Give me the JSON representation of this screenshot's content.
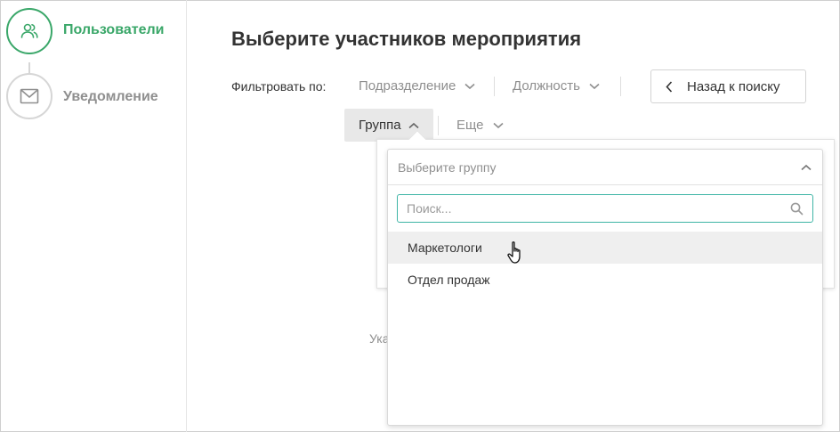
{
  "sidebar": {
    "steps": [
      {
        "label": "Пользователи",
        "icon": "users-icon",
        "state": "active"
      },
      {
        "label": "Уведомление",
        "icon": "envelope-icon",
        "state": "inactive"
      }
    ]
  },
  "main": {
    "title": "Выберите участников мероприятия",
    "filter_label": "Фильтровать по:",
    "filters": {
      "department": "Подразделение",
      "position": "Должность",
      "group": "Группа",
      "more": "Еще"
    },
    "back_button": "Назад к поиску",
    "partial_text": "Ука"
  },
  "dropdown": {
    "header": "Выберите группу",
    "search_placeholder": "Поиск...",
    "items": [
      "Маркетологи",
      "Отдел продаж"
    ]
  },
  "colors": {
    "accent_green": "#3aa769",
    "search_border": "#3fb5a6"
  }
}
